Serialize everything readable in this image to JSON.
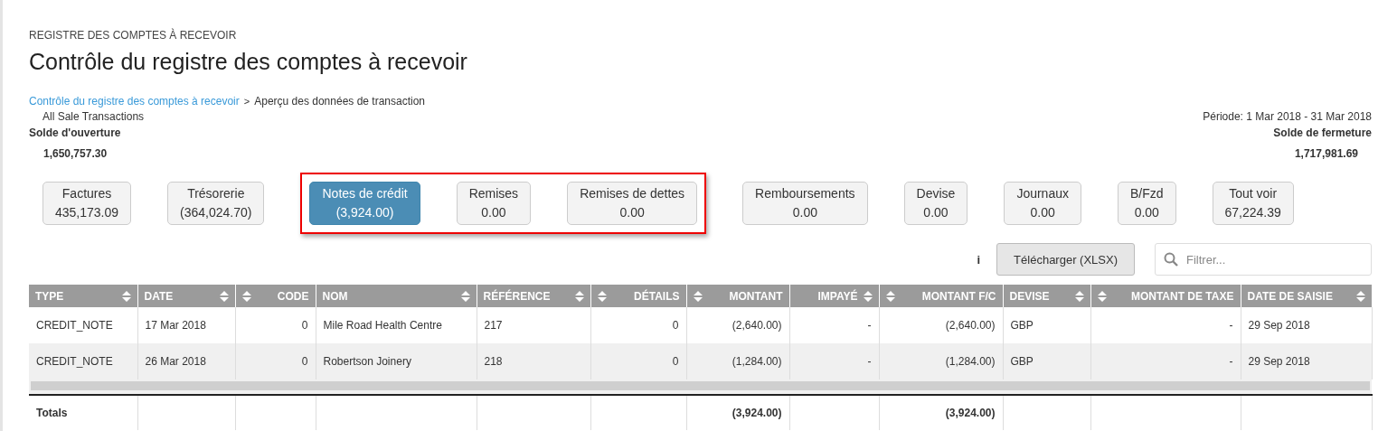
{
  "section": "REGISTRE DES COMPTES À RECEVOIR",
  "title": "Contrôle du registre des comptes à recevoir",
  "breadcrumb": [
    {
      "label": "Contrôle du registre des comptes à recevoir",
      "link": true
    },
    {
      "label": "Aperçu des données de transaction",
      "link": false
    }
  ],
  "breadcrumb_separator": ">",
  "subtitle": "All Sale Transactions",
  "period": "Période: 1 Mar 2018 - 31 Mar 2018",
  "opening": {
    "label": "Solde d'ouverture",
    "value": "1,650,757.30"
  },
  "closing": {
    "label": "Solde de fermeture",
    "value": "1,717,981.69"
  },
  "filters": [
    {
      "label": "Factures",
      "value": "435,173.09",
      "selected": false,
      "highlighted": false
    },
    {
      "label": "Trésorerie",
      "value": "(364,024.70)",
      "selected": false,
      "highlighted": false
    },
    {
      "label": "Notes de crédit",
      "value": "(3,924.00)",
      "selected": true,
      "highlighted": true
    },
    {
      "label": "Remises",
      "value": "0.00",
      "selected": false,
      "highlighted": true
    },
    {
      "label": "Remises de dettes",
      "value": "0.00",
      "selected": false,
      "highlighted": true
    },
    {
      "label": "Remboursements",
      "value": "0.00",
      "selected": false,
      "highlighted": false
    },
    {
      "label": "Devise",
      "value": "0.00",
      "selected": false,
      "highlighted": false
    },
    {
      "label": "Journaux",
      "value": "0.00",
      "selected": false,
      "highlighted": false
    },
    {
      "label": "B/Fzd",
      "value": "0.00",
      "selected": false,
      "highlighted": false
    },
    {
      "label": "Tout voir",
      "value": "67,224.39",
      "selected": false,
      "highlighted": false
    }
  ],
  "info": "i",
  "download_button": "Télécharger (XLSX)",
  "filter_field": {
    "placeholder": "Filtrer..."
  },
  "table": {
    "columns": [
      {
        "label": "TYPE",
        "kind": "text"
      },
      {
        "label": "DATE",
        "kind": "text"
      },
      {
        "label": "CODE",
        "kind": "number"
      },
      {
        "label": "NOM",
        "kind": "text"
      },
      {
        "label": "RÉFÉRENCE",
        "kind": "text"
      },
      {
        "label": "DÉTAILS",
        "kind": "number"
      },
      {
        "label": "MONTANT",
        "kind": "number"
      },
      {
        "label": "IMPAYÉ",
        "kind": "status"
      },
      {
        "label": "MONTANT F/C",
        "kind": "number"
      },
      {
        "label": "DEVISE",
        "kind": "text"
      },
      {
        "label": "MONTANT DE TAXE",
        "kind": "number"
      },
      {
        "label": "DATE DE SAISIE",
        "kind": "text"
      }
    ],
    "rows": [
      [
        "CREDIT_NOTE",
        "17 Mar 2018",
        "0",
        "Mile Road Health Centre",
        "217",
        "0",
        "(2,640.00)",
        "-",
        "(2,640.00)",
        "GBP",
        "-",
        "29 Sep 2018"
      ],
      [
        "CREDIT_NOTE",
        "26 Mar 2018",
        "0",
        "Robertson Joinery",
        "218",
        "0",
        "(1,284.00)",
        "-",
        "(1,284.00)",
        "GBP",
        "-",
        "29 Sep 2018"
      ]
    ],
    "totals": {
      "label": "Totals",
      "montant": "(3,924.00)",
      "montant_fc": "(3,924.00)"
    }
  }
}
